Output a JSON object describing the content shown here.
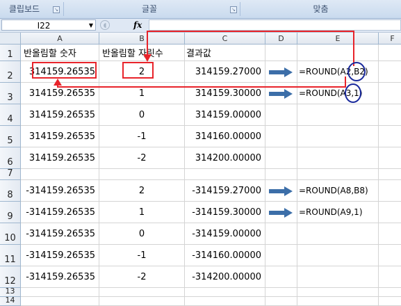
{
  "ribbon": {
    "groups": [
      {
        "label": "클립보드"
      },
      {
        "label": "글꼴"
      },
      {
        "label": "맞춤"
      }
    ]
  },
  "formula_bar": {
    "name_box": "I22",
    "fx_label": "fx",
    "formula": ""
  },
  "columns": [
    "A",
    "B",
    "C",
    "D",
    "E",
    "F"
  ],
  "rows": [
    {
      "num": "1",
      "a": "반올림할 숫자",
      "b": "반올림할 자릿수",
      "c": "결과값",
      "e": ""
    },
    {
      "num": "2",
      "a": "314159.26535",
      "b": "2",
      "c": "314159.27000",
      "e": "=ROUND(A2,B2)"
    },
    {
      "num": "3",
      "a": "314159.26535",
      "b": "1",
      "c": "314159.30000",
      "e": "=ROUND(A3,1)"
    },
    {
      "num": "4",
      "a": "314159.26535",
      "b": "0",
      "c": "314159.00000",
      "e": ""
    },
    {
      "num": "5",
      "a": "314159.26535",
      "b": "-1",
      "c": "314160.00000",
      "e": ""
    },
    {
      "num": "6",
      "a": "314159.26535",
      "b": "-2",
      "c": "314200.00000",
      "e": ""
    },
    {
      "num": "7",
      "a": "",
      "b": "",
      "c": "",
      "e": ""
    },
    {
      "num": "8",
      "a": "-314159.26535",
      "b": "2",
      "c": "-314159.27000",
      "e": "=ROUND(A8,B8)"
    },
    {
      "num": "9",
      "a": "-314159.26535",
      "b": "1",
      "c": "-314159.30000",
      "e": "=ROUND(A9,1)"
    },
    {
      "num": "10",
      "a": "-314159.26535",
      "b": "0",
      "c": "-314159.00000",
      "e": ""
    },
    {
      "num": "11",
      "a": "-314159.26535",
      "b": "-1",
      "c": "-314160.00000",
      "e": ""
    },
    {
      "num": "12",
      "a": "-314159.26535",
      "b": "-2",
      "c": "-314200.00000",
      "e": ""
    },
    {
      "num": "13",
      "a": "",
      "b": "",
      "c": "",
      "e": ""
    },
    {
      "num": "14",
      "a": "",
      "b": "",
      "c": "",
      "e": ""
    }
  ],
  "colors": {
    "annotation_red": "#e8232a",
    "annotation_blue": "#1a2a9c",
    "arrow_blue": "#3c6ea8"
  },
  "icons": {
    "arrow": "right-arrow-icon",
    "dropdown": "chevron-down-icon",
    "launcher": "dialog-launcher-icon"
  }
}
